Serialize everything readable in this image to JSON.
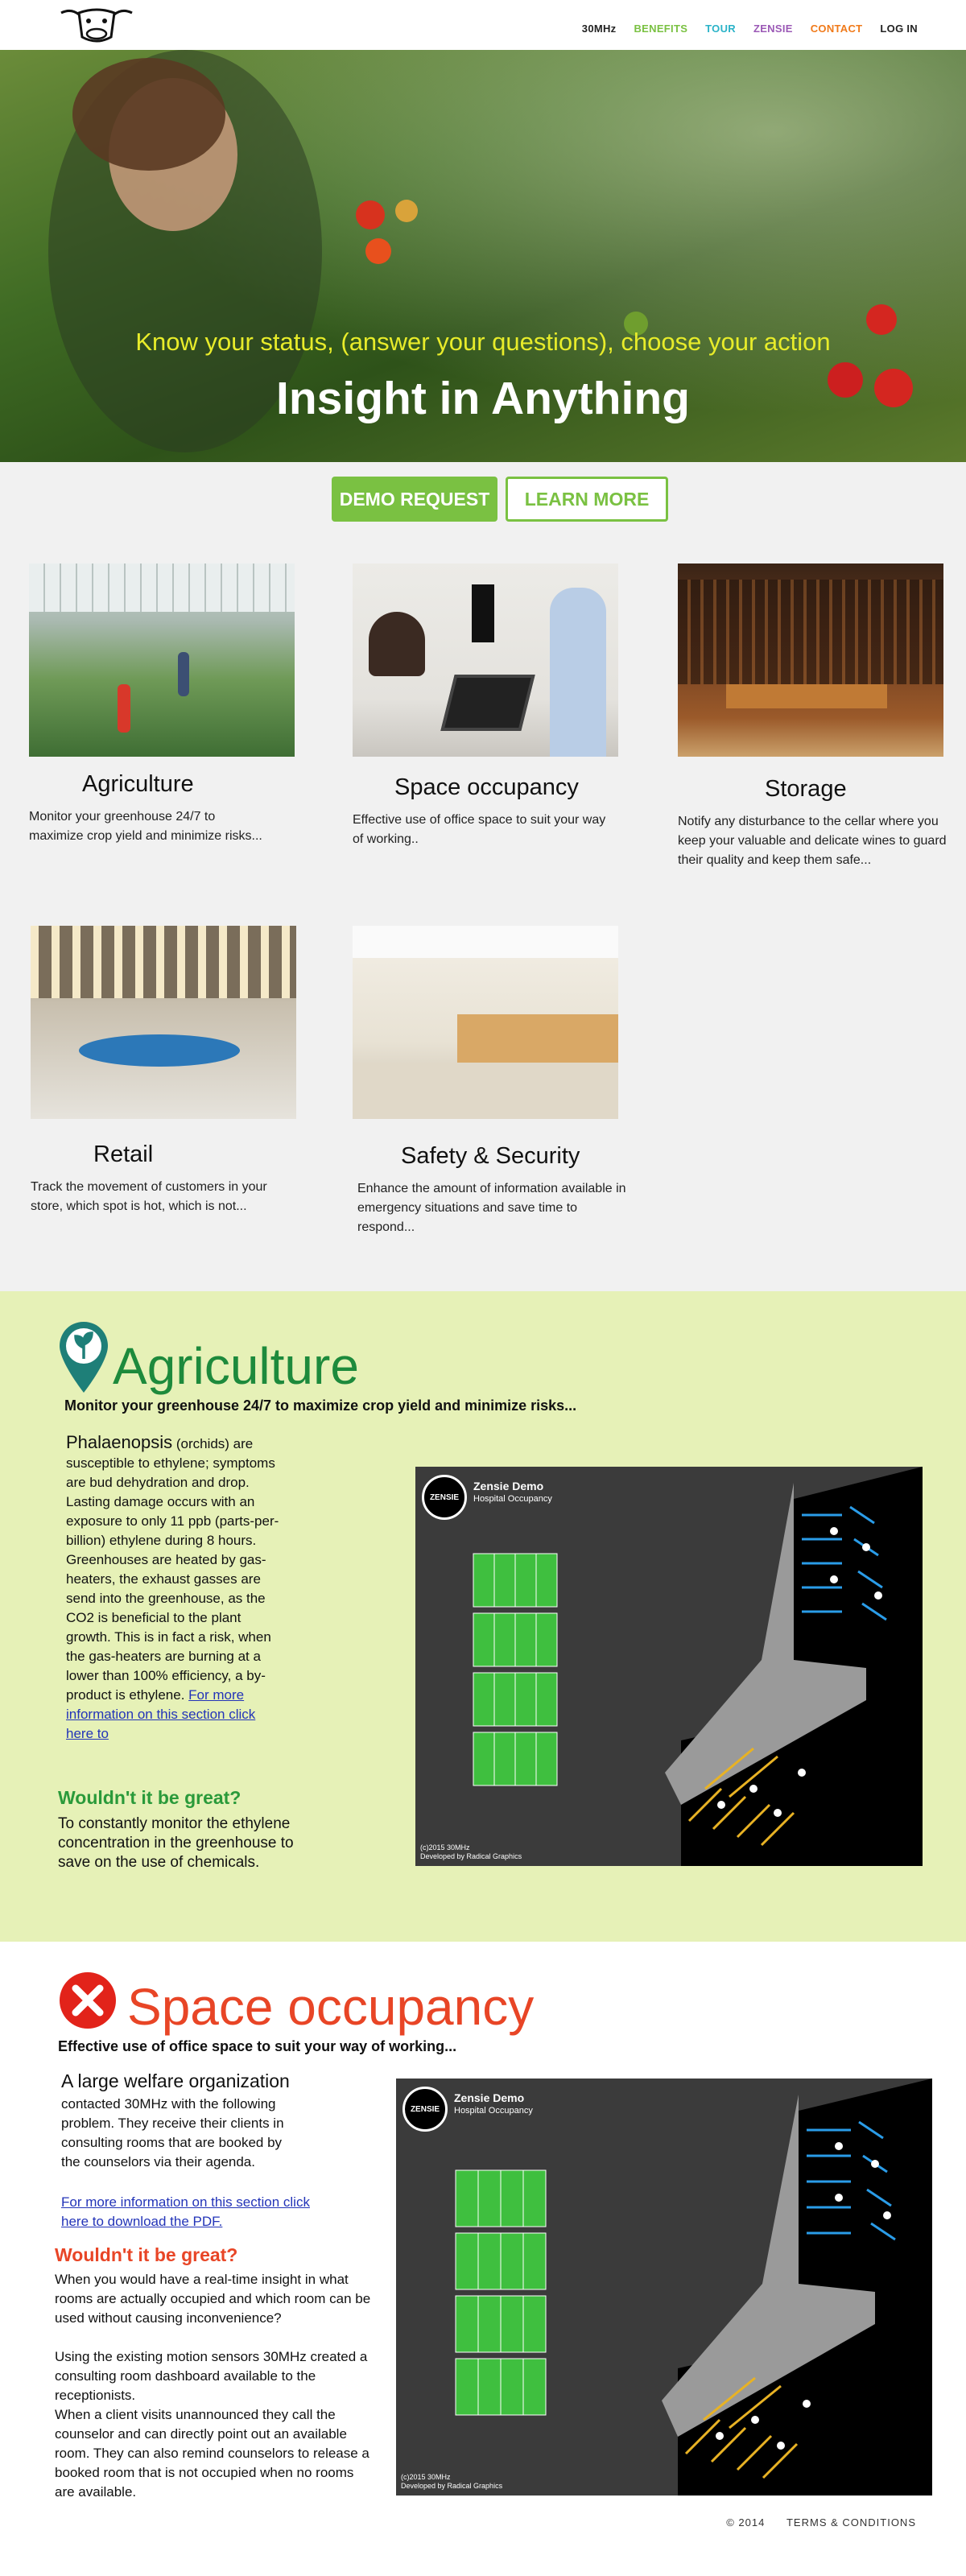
{
  "nav": {
    "items": [
      {
        "label": "30MHz",
        "color": "#222222"
      },
      {
        "label": "BENEFITS",
        "color": "#7ac142"
      },
      {
        "label": "TOUR",
        "color": "#2bb3c8"
      },
      {
        "label": "ZENSIE",
        "color": "#9b59b6"
      },
      {
        "label": "CONTACT",
        "color": "#f07a1a"
      },
      {
        "label": "LOG IN",
        "color": "#222222"
      }
    ]
  },
  "hero": {
    "tagline": "Know your status, (answer your questions), choose your action",
    "title": "Insight in Anything"
  },
  "buttons": {
    "demo": "DEMO REQUEST",
    "learn": "LEARN MORE"
  },
  "cards": [
    {
      "title": "Agriculture",
      "text": "Monitor your greenhouse 24/7 to maximize crop yield and minimize risks..."
    },
    {
      "title": "Space occupancy",
      "text": "Effective use of office space to suit your way of working.."
    },
    {
      "title": "Storage",
      "text": "Notify any disturbance to the cellar where you keep your valuable and delicate wines to guard their quality and keep them safe..."
    },
    {
      "title": "Retail",
      "text": "Track the movement of customers in your store, which spot is hot, which is not..."
    },
    {
      "title": "Safety & Security",
      "text": "Enhance the amount of information available in emergency situations and save time to respond..."
    }
  ],
  "agriculture": {
    "title": "Agriculture",
    "subtitle": "Monitor your greenhouse 24/7 to maximize crop yield and minimize risks...",
    "lead": "Phalaenopsis",
    "lead_suffix": " (orchids) are susceptible to ethylene; symptoms are bud dehydration and drop. Lasting damage occurs with an exposure to only 11 ppb (parts-per-billion) ethylene during 8 hours. Greenhouses are heated by gas-heaters, the exhaust gasses are send into the greenhouse, as the CO2 is beneficial to the plant growth. This is in fact a risk, when the gas-heaters are burning at a lower than 100% efficiency, a by-product is ethylene. ",
    "link": "For more information on this section click here to",
    "great_title": "Wouldn't it be great?",
    "great_text": "To constantly monitor the ethylene concentration in the greenhouse to save on the use of chemicals."
  },
  "demo": {
    "badge": "ZENSIE",
    "title": "Zensie Demo",
    "subtitle": "Hospital Occupancy",
    "footer_1": "(c)2015 30MHz",
    "footer_2": "Developed by Radical Graphics"
  },
  "space": {
    "title": "Space occupancy",
    "subtitle": "Effective use of office space to suit your way of working...",
    "lead": "A large welfare organization",
    "body": "contacted 30MHz with the following problem. They receive their clients in consulting rooms that are booked by the counselors via their agenda.",
    "link": "For more information on this section click here to download the PDF.",
    "great_title": "Wouldn't it be great?",
    "great_text": "When you would have a real-time insight in what rooms are actually occupied and which room can be used without causing inconvenience?",
    "para_2": "Using the existing motion sensors 30MHz created a consulting room dashboard available to the receptionists.",
    "para_3": "When a client visits unannounced they call the counselor and can directly point out an available room. They can also remind counselors to release a booked room that is not occupied when no rooms are available."
  },
  "footer": {
    "copyright": "© 2014",
    "terms": "TERMS & CONDITIONS"
  }
}
